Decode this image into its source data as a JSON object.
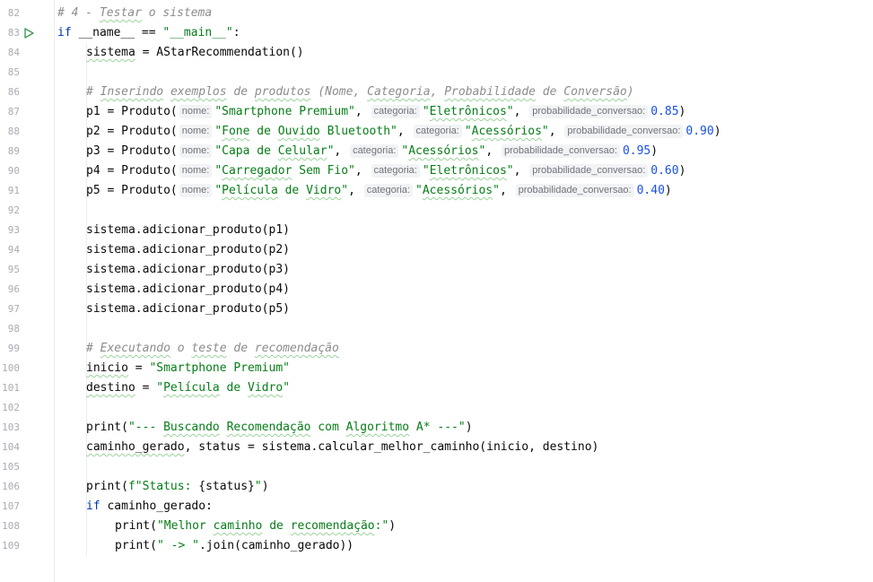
{
  "editor": {
    "lines": [
      {
        "n": "82",
        "ind": 0,
        "toks": [
          {
            "t": "# 4 - ",
            "c": "cm"
          },
          {
            "t": "Testar",
            "c": "cm",
            "sq": true
          },
          {
            "t": " o sistema",
            "c": "cm"
          }
        ]
      },
      {
        "n": "83",
        "run": true,
        "ind": 0,
        "toks": [
          {
            "t": "if",
            "c": "kw"
          },
          {
            "t": " __name__ == "
          },
          {
            "t": "\"__main__\"",
            "c": "str"
          },
          {
            "t": ":"
          }
        ]
      },
      {
        "n": "84",
        "ind": 1,
        "toks": [
          {
            "t": "sistema",
            "sq": true
          },
          {
            "t": " = AStarRecommendation()"
          }
        ]
      },
      {
        "n": "85",
        "ind": 1,
        "toks": []
      },
      {
        "n": "86",
        "ind": 1,
        "toks": [
          {
            "t": "# ",
            "c": "cm"
          },
          {
            "t": "Inserindo",
            "c": "cm",
            "sq": true
          },
          {
            "t": " ",
            "c": "cm"
          },
          {
            "t": "exemplos",
            "c": "cm",
            "sq": true
          },
          {
            "t": " de ",
            "c": "cm"
          },
          {
            "t": "produtos",
            "c": "cm",
            "sq": true
          },
          {
            "t": " (Nome, ",
            "c": "cm"
          },
          {
            "t": "Categoria",
            "c": "cm",
            "sq": true
          },
          {
            "t": ", ",
            "c": "cm"
          },
          {
            "t": "Probabilidade",
            "c": "cm",
            "sq": true
          },
          {
            "t": " de ",
            "c": "cm"
          },
          {
            "t": "Conversão",
            "c": "cm",
            "sq": true
          },
          {
            "t": ")",
            "c": "cm"
          }
        ]
      },
      {
        "n": "87",
        "ind": 1,
        "toks": [
          {
            "t": "p1 = Produto("
          },
          {
            "t": "nome:",
            "c": "hint"
          },
          {
            "t": "\"Smartphone Premium\"",
            "c": "str"
          },
          {
            "t": ", "
          },
          {
            "t": "categoria:",
            "c": "hint"
          },
          {
            "t": "\"",
            "c": "str"
          },
          {
            "t": "Eletrônicos",
            "c": "str",
            "sq": true
          },
          {
            "t": "\"",
            "c": "str"
          },
          {
            "t": ", "
          },
          {
            "t": "probabilidade_conversao:",
            "c": "hint"
          },
          {
            "t": "0.85",
            "c": "num"
          },
          {
            "t": ")"
          }
        ]
      },
      {
        "n": "88",
        "ind": 1,
        "toks": [
          {
            "t": "p2 = Produto("
          },
          {
            "t": "nome:",
            "c": "hint"
          },
          {
            "t": "\"",
            "c": "str"
          },
          {
            "t": "Fone",
            "c": "str",
            "sq": true
          },
          {
            "t": " de ",
            "c": "str"
          },
          {
            "t": "Ouvido",
            "c": "str",
            "sq": true
          },
          {
            "t": " Bluetooth\"",
            "c": "str"
          },
          {
            "t": ", "
          },
          {
            "t": "categoria:",
            "c": "hint"
          },
          {
            "t": "\"",
            "c": "str"
          },
          {
            "t": "Acessórios",
            "c": "str",
            "sq": true
          },
          {
            "t": "\"",
            "c": "str"
          },
          {
            "t": ", "
          },
          {
            "t": "probabilidade_conversao:",
            "c": "hint"
          },
          {
            "t": "0.90",
            "c": "num"
          },
          {
            "t": ")"
          }
        ]
      },
      {
        "n": "89",
        "ind": 1,
        "toks": [
          {
            "t": "p3 = Produto("
          },
          {
            "t": "nome:",
            "c": "hint"
          },
          {
            "t": "\"Capa de ",
            "c": "str"
          },
          {
            "t": "Celular",
            "c": "str",
            "sq": true
          },
          {
            "t": "\"",
            "c": "str"
          },
          {
            "t": ", "
          },
          {
            "t": "categoria:",
            "c": "hint"
          },
          {
            "t": "\"",
            "c": "str"
          },
          {
            "t": "Acessórios",
            "c": "str",
            "sq": true
          },
          {
            "t": "\"",
            "c": "str"
          },
          {
            "t": ", "
          },
          {
            "t": "probabilidade_conversao:",
            "c": "hint"
          },
          {
            "t": "0.95",
            "c": "num"
          },
          {
            "t": ")"
          }
        ]
      },
      {
        "n": "90",
        "ind": 1,
        "toks": [
          {
            "t": "p4 = Produto("
          },
          {
            "t": "nome:",
            "c": "hint"
          },
          {
            "t": "\"",
            "c": "str"
          },
          {
            "t": "Carregador",
            "c": "str",
            "sq": true
          },
          {
            "t": " Sem Fio\"",
            "c": "str"
          },
          {
            "t": ", "
          },
          {
            "t": "categoria:",
            "c": "hint"
          },
          {
            "t": "\"",
            "c": "str"
          },
          {
            "t": "Eletrônicos",
            "c": "str",
            "sq": true
          },
          {
            "t": "\"",
            "c": "str"
          },
          {
            "t": ", "
          },
          {
            "t": "probabilidade_conversao:",
            "c": "hint"
          },
          {
            "t": "0.60",
            "c": "num"
          },
          {
            "t": ")"
          }
        ]
      },
      {
        "n": "91",
        "ind": 1,
        "toks": [
          {
            "t": "p5 = Produto("
          },
          {
            "t": "nome:",
            "c": "hint"
          },
          {
            "t": "\"",
            "c": "str"
          },
          {
            "t": "Película",
            "c": "str",
            "sq": true
          },
          {
            "t": " de ",
            "c": "str"
          },
          {
            "t": "Vidro",
            "c": "str",
            "sq": true
          },
          {
            "t": "\"",
            "c": "str"
          },
          {
            "t": ", "
          },
          {
            "t": "categoria:",
            "c": "hint"
          },
          {
            "t": "\"",
            "c": "str"
          },
          {
            "t": "Acessórios",
            "c": "str",
            "sq": true
          },
          {
            "t": "\"",
            "c": "str"
          },
          {
            "t": ", "
          },
          {
            "t": "probabilidade_conversao:",
            "c": "hint"
          },
          {
            "t": "0.40",
            "c": "num"
          },
          {
            "t": ")"
          }
        ]
      },
      {
        "n": "92",
        "ind": 1,
        "toks": []
      },
      {
        "n": "93",
        "ind": 1,
        "toks": [
          {
            "t": "sistema.adicionar_produto(p1)"
          }
        ]
      },
      {
        "n": "94",
        "ind": 1,
        "toks": [
          {
            "t": "sistema.adicionar_produto(p2)"
          }
        ]
      },
      {
        "n": "95",
        "ind": 1,
        "toks": [
          {
            "t": "sistema.adicionar_produto(p3)"
          }
        ]
      },
      {
        "n": "96",
        "ind": 1,
        "toks": [
          {
            "t": "sistema.adicionar_produto(p4)"
          }
        ]
      },
      {
        "n": "97",
        "ind": 1,
        "toks": [
          {
            "t": "sistema.adicionar_produto(p5)"
          }
        ]
      },
      {
        "n": "98",
        "ind": 1,
        "toks": []
      },
      {
        "n": "99",
        "ind": 1,
        "toks": [
          {
            "t": "# ",
            "c": "cm"
          },
          {
            "t": "Executando",
            "c": "cm",
            "sq": true
          },
          {
            "t": " o ",
            "c": "cm"
          },
          {
            "t": "teste",
            "c": "cm",
            "sq": true
          },
          {
            "t": " de ",
            "c": "cm"
          },
          {
            "t": "recomendação",
            "c": "cm",
            "sq": true
          }
        ]
      },
      {
        "n": "100",
        "ind": 1,
        "toks": [
          {
            "t": "inicio",
            "sq": true
          },
          {
            "t": " = "
          },
          {
            "t": "\"Smartphone Premium\"",
            "c": "str"
          }
        ]
      },
      {
        "n": "101",
        "ind": 1,
        "toks": [
          {
            "t": "destino",
            "sq": true
          },
          {
            "t": " = "
          },
          {
            "t": "\"",
            "c": "str"
          },
          {
            "t": "Película",
            "c": "str",
            "sq": true
          },
          {
            "t": " de ",
            "c": "str"
          },
          {
            "t": "Vidro",
            "c": "str",
            "sq": true
          },
          {
            "t": "\"",
            "c": "str"
          }
        ]
      },
      {
        "n": "102",
        "ind": 1,
        "toks": []
      },
      {
        "n": "103",
        "ind": 1,
        "toks": [
          {
            "t": "print",
            "c": "fn"
          },
          {
            "t": "("
          },
          {
            "t": "\"--- ",
            "c": "str"
          },
          {
            "t": "Buscando",
            "c": "str",
            "sq": true
          },
          {
            "t": " ",
            "c": "str"
          },
          {
            "t": "Recomendação",
            "c": "str",
            "sq": true
          },
          {
            "t": " com ",
            "c": "str"
          },
          {
            "t": "Algoritmo",
            "c": "str",
            "sq": true
          },
          {
            "t": " A* ---\"",
            "c": "str"
          },
          {
            "t": ")"
          }
        ]
      },
      {
        "n": "104",
        "ind": 1,
        "toks": [
          {
            "t": "caminho_gerado",
            "sq": true
          },
          {
            "t": ", status = sistema.calcular_melhor_caminho(inicio, destino)"
          }
        ]
      },
      {
        "n": "105",
        "ind": 1,
        "toks": []
      },
      {
        "n": "106",
        "ind": 1,
        "toks": [
          {
            "t": "print",
            "c": "fn"
          },
          {
            "t": "("
          },
          {
            "t": "f\"Status: ",
            "c": "str"
          },
          {
            "t": "{status}"
          },
          {
            "t": "\"",
            "c": "str"
          },
          {
            "t": ")"
          }
        ]
      },
      {
        "n": "107",
        "ind": 1,
        "toks": [
          {
            "t": "if",
            "c": "kw"
          },
          {
            "t": " caminho_gerado:"
          }
        ]
      },
      {
        "n": "108",
        "ind": 2,
        "toks": [
          {
            "t": "print",
            "c": "fn"
          },
          {
            "t": "("
          },
          {
            "t": "\"Melhor ",
            "c": "str"
          },
          {
            "t": "caminho",
            "c": "str",
            "sq": true
          },
          {
            "t": " de ",
            "c": "str"
          },
          {
            "t": "recomendação",
            "c": "str",
            "sq": true
          },
          {
            "t": ":\"",
            "c": "str"
          },
          {
            "t": ")"
          }
        ]
      },
      {
        "n": "109",
        "ind": 2,
        "toks": [
          {
            "t": "print",
            "c": "fn"
          },
          {
            "t": "("
          },
          {
            "t": "\" -> \"",
            "c": "str"
          },
          {
            "t": ".join(caminho_gerado))"
          }
        ]
      }
    ]
  }
}
